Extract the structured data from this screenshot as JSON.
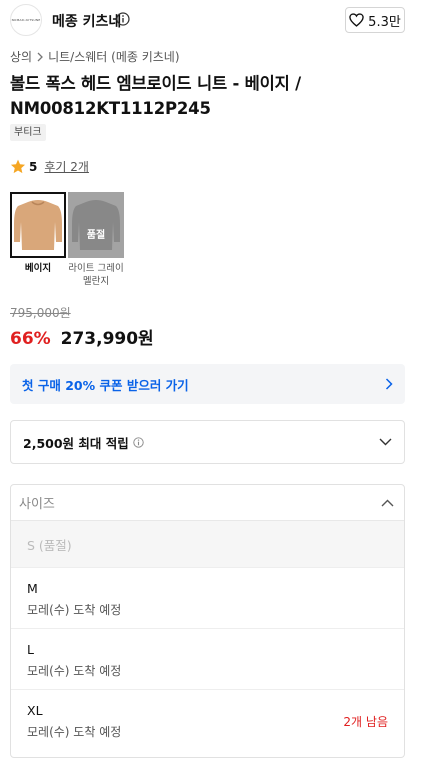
{
  "header": {
    "brand_logo_text": "NOMAD•KITSUNE",
    "brand_name": "메종 키츠네",
    "like_count": "5.3만"
  },
  "breadcrumb": [
    "상의",
    "니트/스웨터 (메종 키츠네)"
  ],
  "product": {
    "title": "볼드 폭스 헤드 엠브로이드 니트 - 베이지 / NM00812KT1112P245",
    "tag": "부티크",
    "rating": "5",
    "review_link": "후기 2개"
  },
  "colors": [
    {
      "name": "베이지",
      "selected": true,
      "soldout": false
    },
    {
      "name": "라이트 그레이 멜란지",
      "selected": false,
      "soldout": true,
      "soldout_label": "품절"
    }
  ],
  "price": {
    "original": "795,000원",
    "discount": "66%",
    "sale": "273,990원"
  },
  "coupon": {
    "text": "첫 구매 20% 쿠폰 받으러 가기"
  },
  "points": {
    "text": "2,500원 최대 적립"
  },
  "size_select": {
    "placeholder": "사이즈",
    "options": [
      {
        "name": "S (품절)",
        "soldout": true
      },
      {
        "name": "M",
        "delivery": "모레(수) 도착 예정",
        "stock": ""
      },
      {
        "name": "L",
        "delivery": "모레(수) 도착 예정",
        "stock": ""
      },
      {
        "name": "XL",
        "delivery": "모레(수) 도착 예정",
        "stock": "2개 남음"
      }
    ]
  },
  "colors_hex": {
    "accent_red": "#e02020",
    "link_blue": "#0a63e8",
    "star": "#f5a623"
  }
}
